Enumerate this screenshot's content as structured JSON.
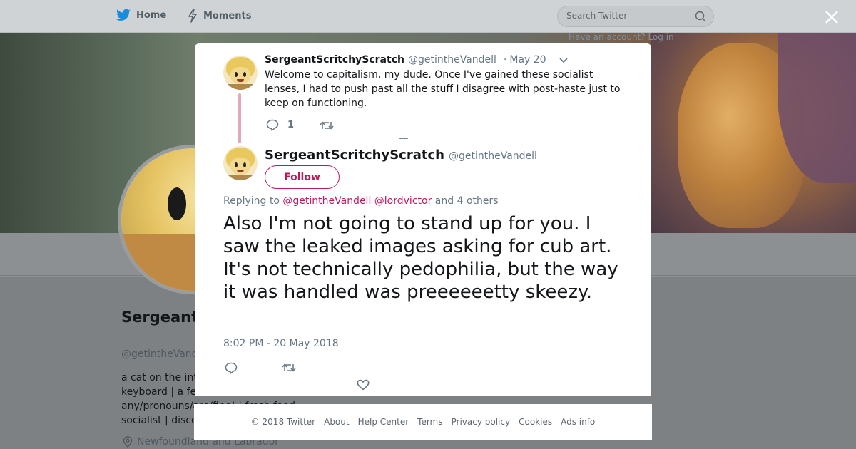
{
  "nav": {
    "home_label": "Home",
    "moments_label": "Moments",
    "search_placeholder": "Search Twitter",
    "have_account": "Have an account? Log in"
  },
  "profile": {
    "display_name": "SergeantScritchyScratch",
    "handle": "@getintheVandell",
    "bio_lines": [
      "a cat on the internet with a",
      "keyboard | a fellow with a",
      "any/pronouns/are/fine! | fresh food",
      "socialist | discord"
    ],
    "location": "Newfoundland and Labrador"
  },
  "parent_tweet": {
    "name": "SergeantScritchyScratch",
    "handle": "@getintheVandell",
    "separator": "·",
    "date": "May 20",
    "text": "Welcome to capitalism, my dude. Once I've gained these socialist lenses, I had to push past all the stuff I disagree with post-haste just to keep on functioning.",
    "reply_count": "1"
  },
  "main_tweet": {
    "name": "SergeantScritchyScratch",
    "handle": "@getintheVandell",
    "follow_label": "Follow",
    "replying_prefix": "Replying to",
    "replying_user1": "@getintheVandell",
    "replying_user2": "@lordvictor",
    "replying_suffix": "and 4 others",
    "text": "Also I'm not going to stand up for you. I saw the leaked images asking for cub art. It's not technically pedophilia, but the way it was handled was preeeeeetty skeezy.",
    "timestamp": "8:02 PM - 20 May 2018"
  },
  "footer": {
    "copyright": "© 2018 Twitter",
    "about": "About",
    "help": "Help Center",
    "terms": "Terms",
    "privacy": "Privacy policy",
    "cookies": "Cookies",
    "ads": "Ads info"
  },
  "icons": {
    "logo": "twitter-bird-icon",
    "moments": "lightning-icon",
    "search": "search-icon",
    "close": "close-icon",
    "reply": "reply-icon",
    "retweet": "retweet-icon",
    "like": "heart-icon",
    "caret": "chevron-down-icon",
    "location": "location-pin-icon"
  },
  "colors": {
    "twitter_blue": "#1da1f2",
    "accent_pink": "#c2185b",
    "thread_line": "#e5a6bf",
    "muted_text": "#657786"
  }
}
